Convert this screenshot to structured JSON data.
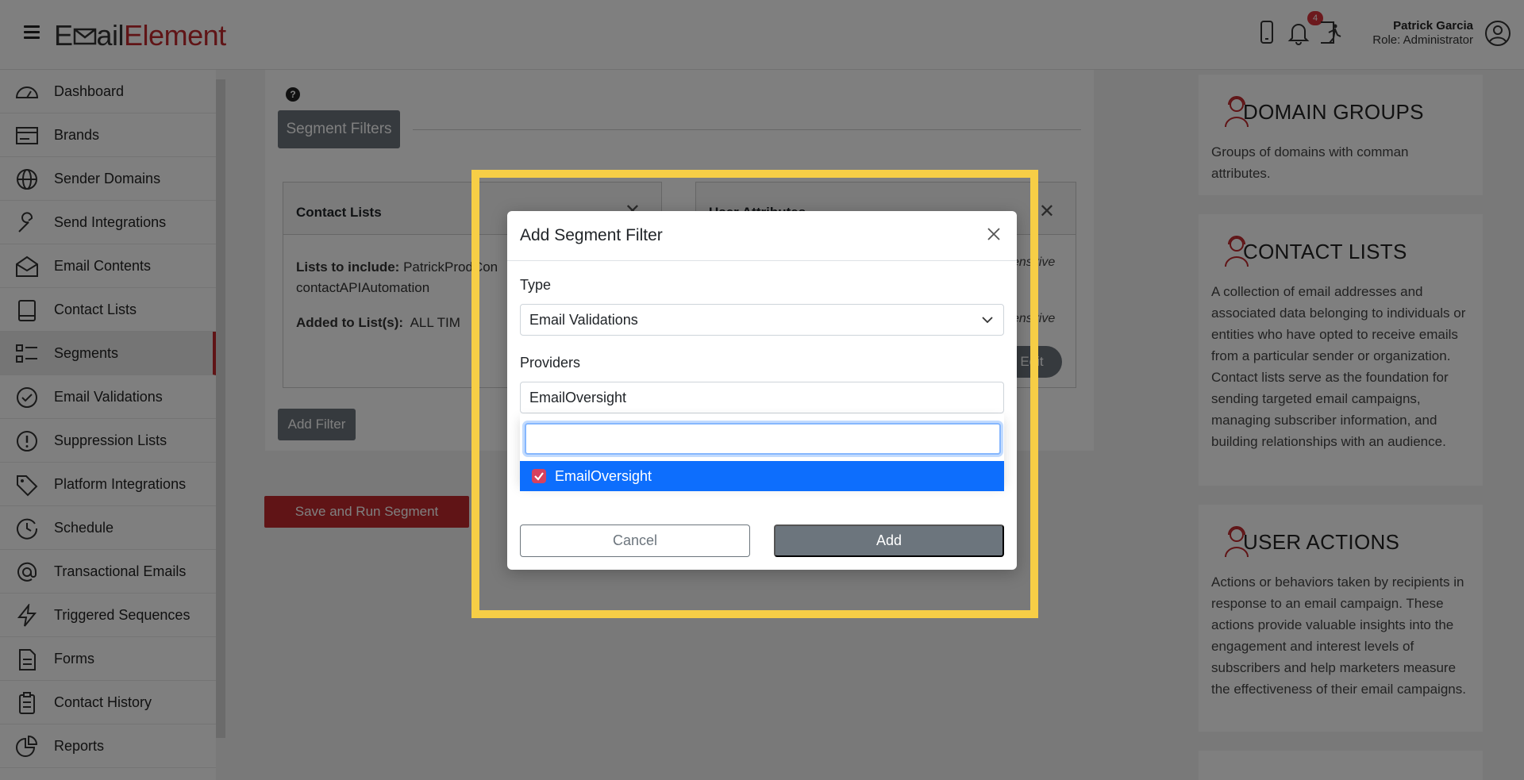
{
  "header": {
    "logo_part1": "E",
    "logo_part2": "ail",
    "logo_part3": "Element",
    "notification_count": "4",
    "user_name": "Patrick Garcia",
    "user_role": "Role: Administrator"
  },
  "sidebar": {
    "items": [
      {
        "label": "Dashboard",
        "icon": "dashboard-icon"
      },
      {
        "label": "Brands",
        "icon": "brands-icon"
      },
      {
        "label": "Sender Domains",
        "icon": "globe-icon"
      },
      {
        "label": "Send Integrations",
        "icon": "wrench-icon"
      },
      {
        "label": "Email Contents",
        "icon": "envelope-icon"
      },
      {
        "label": "Contact Lists",
        "icon": "book-icon"
      },
      {
        "label": "Segments",
        "icon": "list-icon"
      },
      {
        "label": "Email Validations",
        "icon": "check-circle-icon"
      },
      {
        "label": "Suppression Lists",
        "icon": "exclamation-circle-icon"
      },
      {
        "label": "Platform Integrations",
        "icon": "tag-icon"
      },
      {
        "label": "Schedule",
        "icon": "clock-icon"
      },
      {
        "label": "Transactional Emails",
        "icon": "at-icon"
      },
      {
        "label": "Triggered Sequences",
        "icon": "lightning-icon"
      },
      {
        "label": "Forms",
        "icon": "form-icon"
      },
      {
        "label": "Contact History",
        "icon": "clipboard-icon"
      },
      {
        "label": "Reports",
        "icon": "pie-chart-icon"
      }
    ],
    "active": "Segments"
  },
  "main": {
    "help": "?",
    "segment_filters_label": "Segment Filters",
    "contact_lists_card": {
      "title": "Contact Lists",
      "lists_label": "Lists to include:",
      "lists_value": "PatrickProdCon",
      "lists_value2": "contactAPIAutomation",
      "added_label": "Added to List(s):",
      "added_value": "ALL TIM"
    },
    "user_attributes_card": {
      "title": "User Attributes",
      "italic1": "ensitive",
      "italic2": "ensitive",
      "edit_label": "Edit"
    },
    "add_filter_label": "Add Filter",
    "save_run_label": "Save and Run Segment"
  },
  "info_panel": [
    {
      "title": "DOMAIN GROUPS",
      "text": "Groups of domains with comman attributes."
    },
    {
      "title": "CONTACT LISTS",
      "text": "A collection of email addresses and associated data belonging to individuals or entities who have opted to receive emails from a particular sender or organization. Contact lists serve as the foundation for sending targeted email campaigns, managing subscriber information, and building relationships with an audience."
    },
    {
      "title": "USER ACTIONS",
      "text": "Actions or behaviors taken by recipients in response to an email campaign. These actions provide valuable insights into the engagement and interest levels of subscribers and help marketers measure the effectiveness of their email campaigns."
    }
  ],
  "modal": {
    "title": "Add Segment Filter",
    "type_label": "Type",
    "type_value": "Email Validations",
    "providers_label": "Providers",
    "providers_value": "EmailOversight",
    "search_value": "",
    "option_label": "EmailOversight",
    "cancel_label": "Cancel",
    "add_label": "Add"
  },
  "colors": {
    "brand_red": "#c0282d",
    "highlight_yellow": "#f7ce46",
    "option_blue": "#0d6efd",
    "button_gray": "#6c757d"
  }
}
